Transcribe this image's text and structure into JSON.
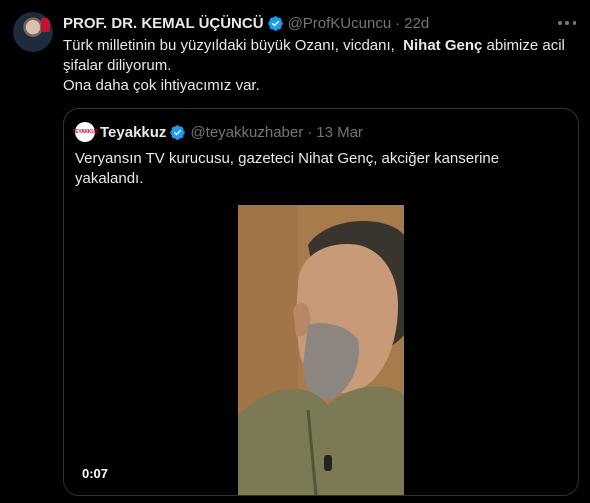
{
  "author": {
    "name": "PROF. DR. KEMAL ÜÇÜNCÜ",
    "handle": "@ProfKUcuncu",
    "separator": "·",
    "time": "22d",
    "verified_color": "#1d9bf0"
  },
  "tweet": {
    "line1_prefix": "Türk milletinin bu yüzyıldaki büyük Ozanı, vicdanı,",
    "line1_bold": "Nihat Genç",
    "line1_suffix": "abimize acil",
    "line2": "şifalar diliyorum.",
    "line3": "Ona daha çok ihtiyacımız var."
  },
  "quote": {
    "avatar_text": "TEYAKKUZ",
    "name": "Teyakkuz",
    "handle": "@teyakkuzhaber",
    "separator": "·",
    "time": "13 Mar",
    "line1": "Veryansın TV kurucusu, gazeteci Nihat Genç, akciğer kanserine",
    "line2": "yakalandı.",
    "video_time": "0:07"
  },
  "icons": {
    "verified": "verified-badge-icon",
    "more": "more-options-icon"
  }
}
